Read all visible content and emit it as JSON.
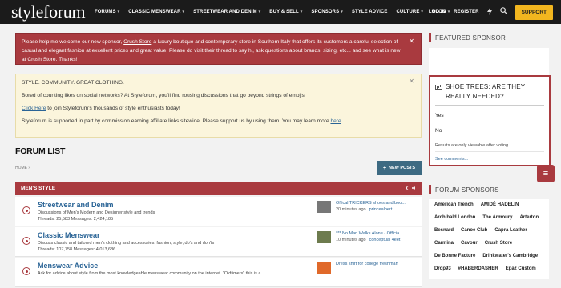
{
  "nav": {
    "logo": "styleforum",
    "items": [
      "FORUMS",
      "CLASSIC MENSWEAR",
      "STREETWEAR AND DENIM",
      "BUY & SELL",
      "SPONSORS",
      "STYLE ADVICE",
      "CULTURE",
      "BLOG"
    ],
    "dropdown_caret": "▾",
    "login": "LOG IN",
    "register": "REGISTER",
    "support": "SUPPORT"
  },
  "sponsor_alert": {
    "text_1": "Please help me welcome our new sponsor, ",
    "link_1": "Crush Store",
    "text_2": " a luxury boutique and contemporary store in Southern Italy that offers its customers a careful selection of casual and elegant fashion at excellent prices and great value. Please do visit their thread to say hi, ask questions about brands, sizing, etc... and see what is new at ",
    "link_2": "Crush Store",
    "text_3": ". Thanks!",
    "close": "✕"
  },
  "info_alert": {
    "headline": "STYLE. COMMUNITY. GREAT CLOTHING.",
    "line_1": "Bored of counting likes on social networks? At Styleforum, you'll find rousing discussions that go beyond strings of emojis.",
    "click_here": "Click Here",
    "line_2_rest": " to join Styleforum's thousands of style enthusiasts today!",
    "line_3": "Styleforum is supported in part by commission earning affiliate links sitewide. Please support us by using them. You may learn more ",
    "here": "here",
    "period": ".",
    "close": "✕"
  },
  "forum_list": {
    "heading": "FORUM LIST",
    "breadcrumb": "HOME",
    "breadcrumb_sep": "›",
    "new_posts_icon": "+",
    "new_posts": "NEW POSTS",
    "category": "MEN'S STYLE",
    "rows": [
      {
        "title": "Streetwear and Denim",
        "desc": "Discussions of Men's Modern and Designer style and trends",
        "stats": "Threads: 25,583 Messages: 2,424,185",
        "latest_title": "Offical TRICKERS shoes and boo...",
        "latest_time": "20 minutes ago",
        "latest_user": "princealbert"
      },
      {
        "title": "Classic Menswear",
        "desc": "Discuss classic and tailored men's clothing and accessories: fashion, style, do's and don'ts",
        "stats": "Threads: 107,758 Messages: 4,013,686",
        "latest_title": "*** No Man Walks Alone - Officia...",
        "latest_time": "10 minutes ago",
        "latest_user": "conceptual 4eet"
      },
      {
        "title": "Menswear Advice",
        "desc": "Ask for advice about style from the most knowledgeable menswear community on the internet. \"Oldtimers\" this is a",
        "stats": "",
        "latest_title": "Dress shirt for college freshman",
        "latest_time": "",
        "latest_user": ""
      }
    ]
  },
  "sidebar": {
    "featured_title": "FEATURED SPONSOR",
    "poll_title": "SHOE TREES: ARE THEY REALLY NEEDED?",
    "poll_options": [
      "Yes",
      "No"
    ],
    "poll_note": "Results are only viewable after voting.",
    "poll_link": "See comments...",
    "chat_icon_glyph": "≡",
    "sponsors_title": "FORUM SPONSORS",
    "sponsors": [
      "American Trench",
      "AMIDÉ HADELIN",
      "Archibald London",
      "The Armoury",
      "Arterton",
      "Besnard",
      "Canoe Club",
      "Capra Leather",
      "Carmina",
      "Cavour",
      "Crush Store",
      "De Bonne Facture",
      "Drinkwater's Cambridge",
      "Drop93",
      "#HABERDASHER",
      "Epaz Custom"
    ]
  },
  "colors": {
    "accent_red": "#a93a3f",
    "nav_bg": "#1b1b1b",
    "support_yellow": "#f2b61f",
    "link_blue": "#2a6496",
    "new_posts_blue": "#3d6a82",
    "info_bg": "#fbf5dc"
  },
  "icons": {
    "search": "search-icon",
    "lightning": "lightning-icon",
    "poll": "bar-chart-icon",
    "toggle": "collapse-toggle-icon",
    "forum_status": "forum-status-icon",
    "chat": "chat-icon"
  }
}
